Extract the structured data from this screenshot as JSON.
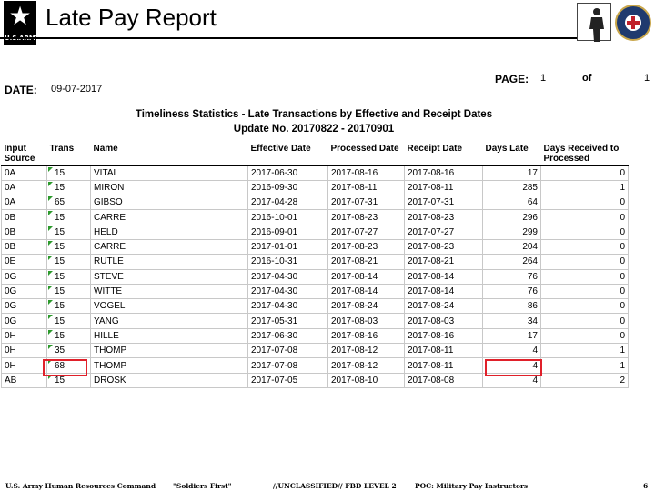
{
  "header": {
    "title": "Late Pay Report",
    "logo_text": "U.S.ARMY",
    "logo_icon": "star-icon"
  },
  "report": {
    "date_label": "DATE:",
    "date_value": "09-07-2017",
    "page_label": "PAGE:",
    "page_number": "1",
    "of_label": "of",
    "page_total": "1",
    "subtitle1": "Timeliness Statistics - Late Transactions by Effective and Receipt Dates",
    "subtitle2": "Update No. 20170822 - 20170901"
  },
  "table": {
    "headers": [
      "Input Source",
      "Trans",
      "Name",
      "Effective Date",
      "Processed Date",
      "Receipt Date",
      "Days Late",
      "Days Received to Processed"
    ],
    "rows": [
      [
        "0A",
        "15",
        "VITAL",
        "2017-06-30",
        "2017-08-16",
        "2017-08-16",
        "17",
        "0"
      ],
      [
        "0A",
        "15",
        "MIRON",
        "2016-09-30",
        "2017-08-11",
        "2017-08-11",
        "285",
        "1"
      ],
      [
        "0A",
        "65",
        "GIBSO",
        "2017-04-28",
        "2017-07-31",
        "2017-07-31",
        "64",
        "0"
      ],
      [
        "0B",
        "15",
        "CARRE",
        "2016-10-01",
        "2017-08-23",
        "2017-08-23",
        "296",
        "0"
      ],
      [
        "0B",
        "15",
        "HELD",
        "2016-09-01",
        "2017-07-27",
        "2017-07-27",
        "299",
        "0"
      ],
      [
        "0B",
        "15",
        "CARRE",
        "2017-01-01",
        "2017-08-23",
        "2017-08-23",
        "204",
        "0"
      ],
      [
        "0E",
        "15",
        "RUTLE",
        "2016-10-31",
        "2017-08-21",
        "2017-08-21",
        "264",
        "0"
      ],
      [
        "0G",
        "15",
        "STEVE",
        "2017-04-30",
        "2017-08-14",
        "2017-08-14",
        "76",
        "0"
      ],
      [
        "0G",
        "15",
        "WITTE",
        "2017-04-30",
        "2017-08-14",
        "2017-08-14",
        "76",
        "0"
      ],
      [
        "0G",
        "15",
        "VOGEL",
        "2017-04-30",
        "2017-08-24",
        "2017-08-24",
        "86",
        "0"
      ],
      [
        "0G",
        "15",
        "YANG",
        "2017-05-31",
        "2017-08-03",
        "2017-08-03",
        "34",
        "0"
      ],
      [
        "0H",
        "15",
        "HILLE",
        "2017-06-30",
        "2017-08-16",
        "2017-08-16",
        "17",
        "0"
      ],
      [
        "0H",
        "35",
        "THOMP",
        "2017-07-08",
        "2017-08-12",
        "2017-08-11",
        "4",
        "1"
      ],
      [
        "0H",
        "68",
        "THOMP",
        "2017-07-08",
        "2017-08-12",
        "2017-08-11",
        "4",
        "1"
      ],
      [
        "AB",
        "15",
        "DROSK",
        "2017-07-05",
        "2017-08-10",
        "2017-08-08",
        "4",
        "2"
      ]
    ]
  },
  "footer": {
    "org": "U.S. Army Human Resources Command",
    "motto": "\"Soldiers First\"",
    "classification": "//UNCLASSIFIED// FBD LEVEL 2",
    "poc": "POC: Military Pay Instructors",
    "slide_number": "6"
  },
  "colors": {
    "highlight": "#e0202a",
    "marker": "#2c9a2c"
  }
}
